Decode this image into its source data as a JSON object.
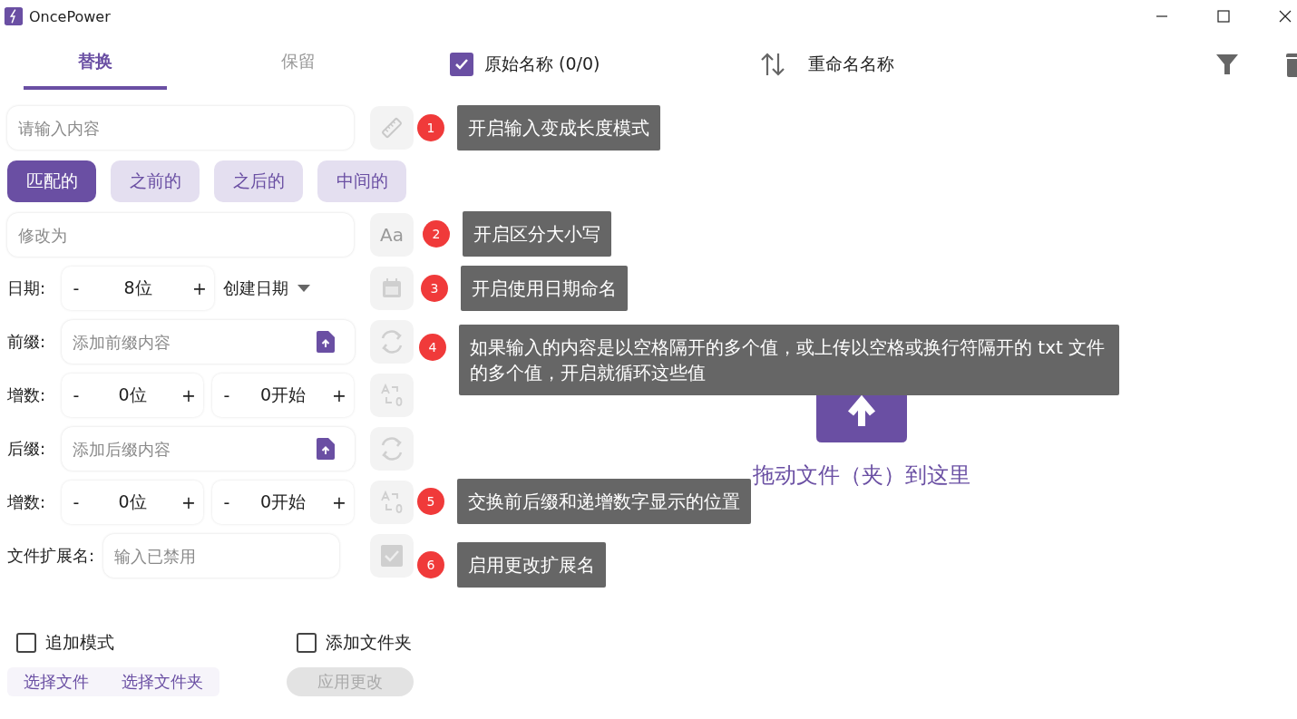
{
  "window": {
    "title": "OncePower"
  },
  "tabs": [
    {
      "label": "替换",
      "selected": true
    },
    {
      "label": "保留",
      "selected": false
    }
  ],
  "search_field": {
    "placeholder": "请输入内容"
  },
  "match_modes": [
    {
      "label": "匹配的",
      "selected": true
    },
    {
      "label": "之前的",
      "selected": false
    },
    {
      "label": "之后的",
      "selected": false
    },
    {
      "label": "中间的",
      "selected": false
    }
  ],
  "replace_field": {
    "placeholder": "修改为"
  },
  "case_toggle": "Aa",
  "date": {
    "label": "日期:",
    "stepper": {
      "minus": "-",
      "value": "8位",
      "plus": "+"
    },
    "source": "创建日期"
  },
  "prefix": {
    "label": "前缀:",
    "placeholder": "添加前缀内容"
  },
  "prefix_counter": {
    "label": "增数:",
    "steppers": [
      {
        "minus": "-",
        "value": "0位",
        "plus": "+"
      },
      {
        "minus": "-",
        "value": "0开始",
        "plus": "+"
      }
    ]
  },
  "suffix": {
    "label": "后缀:",
    "placeholder": "添加后缀内容"
  },
  "suffix_counter": {
    "label": "增数:",
    "steppers": [
      {
        "minus": "-",
        "value": "0位",
        "plus": "+"
      },
      {
        "minus": "-",
        "value": "0开始",
        "plus": "+"
      }
    ]
  },
  "extension": {
    "label": "文件扩展名:",
    "placeholder": "输入已禁用"
  },
  "options": [
    {
      "label": "追加模式",
      "checked": false
    },
    {
      "label": "添加文件夹",
      "checked": false
    }
  ],
  "actions": [
    {
      "label": "选择文件",
      "disabled": false
    },
    {
      "label": "选择文件夹",
      "disabled": false
    },
    {
      "label": "应用更改",
      "disabled": true
    }
  ],
  "file_list": {
    "original_header": {
      "label": "原始名称 (0/0)",
      "checked": true
    },
    "renamed_header": "重命名名称",
    "drop_hint": "拖动文件（夹）到这里"
  },
  "tooltips": [
    {
      "number": "1",
      "text": "开启输入变成长度模式"
    },
    {
      "number": "2",
      "text": "开启区分大小写"
    },
    {
      "number": "3",
      "text": "开启使用日期命名"
    },
    {
      "number": "4",
      "text": "如果输入的内容是以空格隔开的多个值，或上传以空格或换行符隔开的 txt 文件的多个值，开启就循环这些值"
    },
    {
      "number": "5",
      "text": "交换前后缀和递增数字显示的位置"
    },
    {
      "number": "6",
      "text": "启用更改扩展名"
    }
  ]
}
